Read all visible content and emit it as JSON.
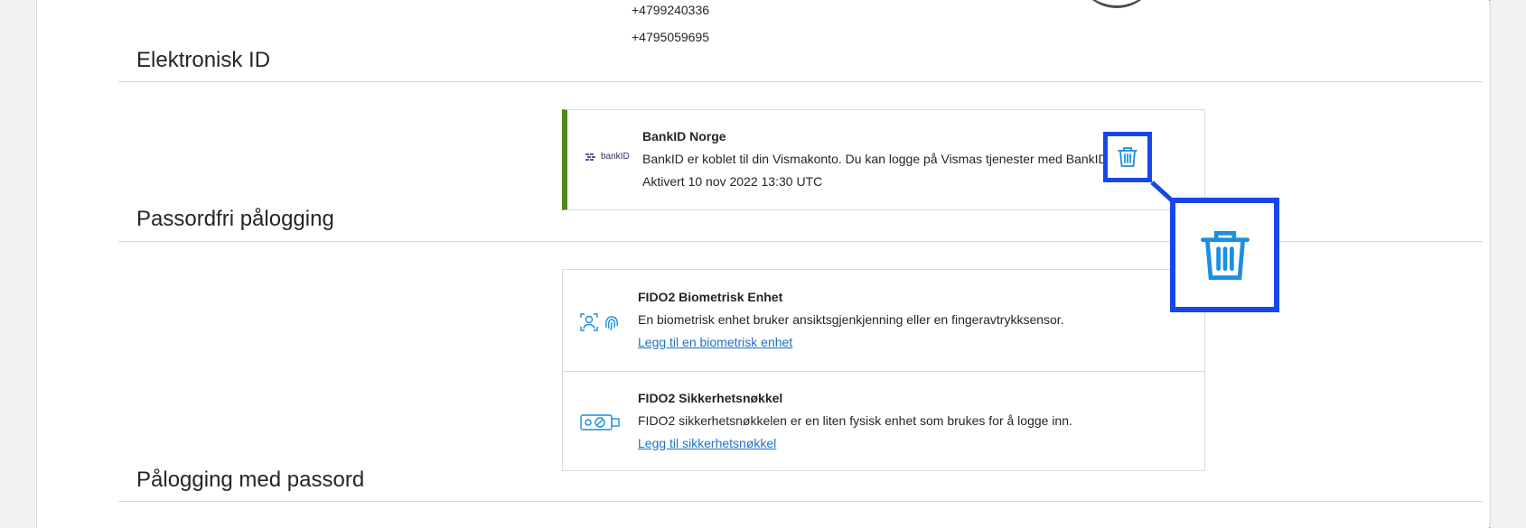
{
  "phones": [
    "+4799240336",
    "+4795059695"
  ],
  "sections": {
    "electronic_id": "Elektronisk ID",
    "passwordless": "Passordfri pålogging",
    "password_login": "Pålogging med passord"
  },
  "bankid": {
    "logo_text": "bankID",
    "title": "BankID Norge",
    "description": "BankID er koblet til din Vismakonto. Du kan logge på Vismas tjenester med BankID.",
    "activated": "Aktivert 10 nov 2022 13:30 UTC",
    "delete_icon": "trash-icon"
  },
  "fido": [
    {
      "title": "FIDO2 Biometrisk Enhet",
      "description": "En biometrisk enhet bruker ansiktsgjenkjenning eller en fingeravtrykksensor.",
      "link": "Legg til en biometrisk enhet",
      "icon": "biometric-icon"
    },
    {
      "title": "FIDO2 Sikkerhetsnøkkel",
      "description": "FIDO2 sikkerhetsnøkkelen er en liten fysisk enhet som brukes for å logge inn.",
      "link": "Legg til sikkerhetsnøkkel",
      "icon": "security-key-icon"
    }
  ],
  "colors": {
    "accent_green": "#4c8a1c",
    "link_blue": "#1a72c4",
    "highlight_blue": "#1747ea",
    "icon_blue": "#1a8fe0"
  }
}
